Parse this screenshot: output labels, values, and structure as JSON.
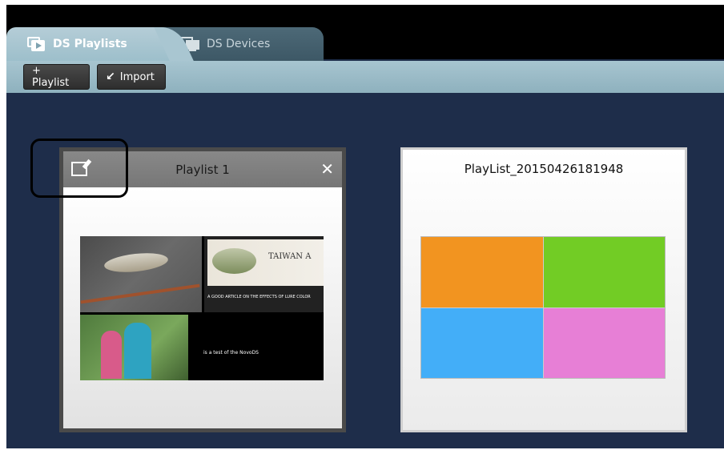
{
  "tabs": [
    {
      "label": "DS Playlists",
      "icon": "playlist-icon",
      "active": true
    },
    {
      "label": "DS Devices",
      "icon": "devices-icon",
      "active": false
    }
  ],
  "toolbar": {
    "add_playlist_label": "+ Playlist",
    "import_label": "Import",
    "import_icon": "import-arrow-icon"
  },
  "playlists": [
    {
      "title": "Playlist 1",
      "thumb_brand": "TAIWAN A",
      "thumb_caption": "A GOOD ARTICLE ON THE EFFECTS OF LURE COLOR",
      "thumb_text": "is a test of the NovoDS"
    },
    {
      "title": "PlayList_20150426181948",
      "colors": [
        "#f29420",
        "#72cc25",
        "#43aef8",
        "#e77fd6"
      ]
    }
  ],
  "colors": {
    "background": "#1e2d4a",
    "toolbar": "#a7c5d0",
    "card_header": "#808080"
  }
}
